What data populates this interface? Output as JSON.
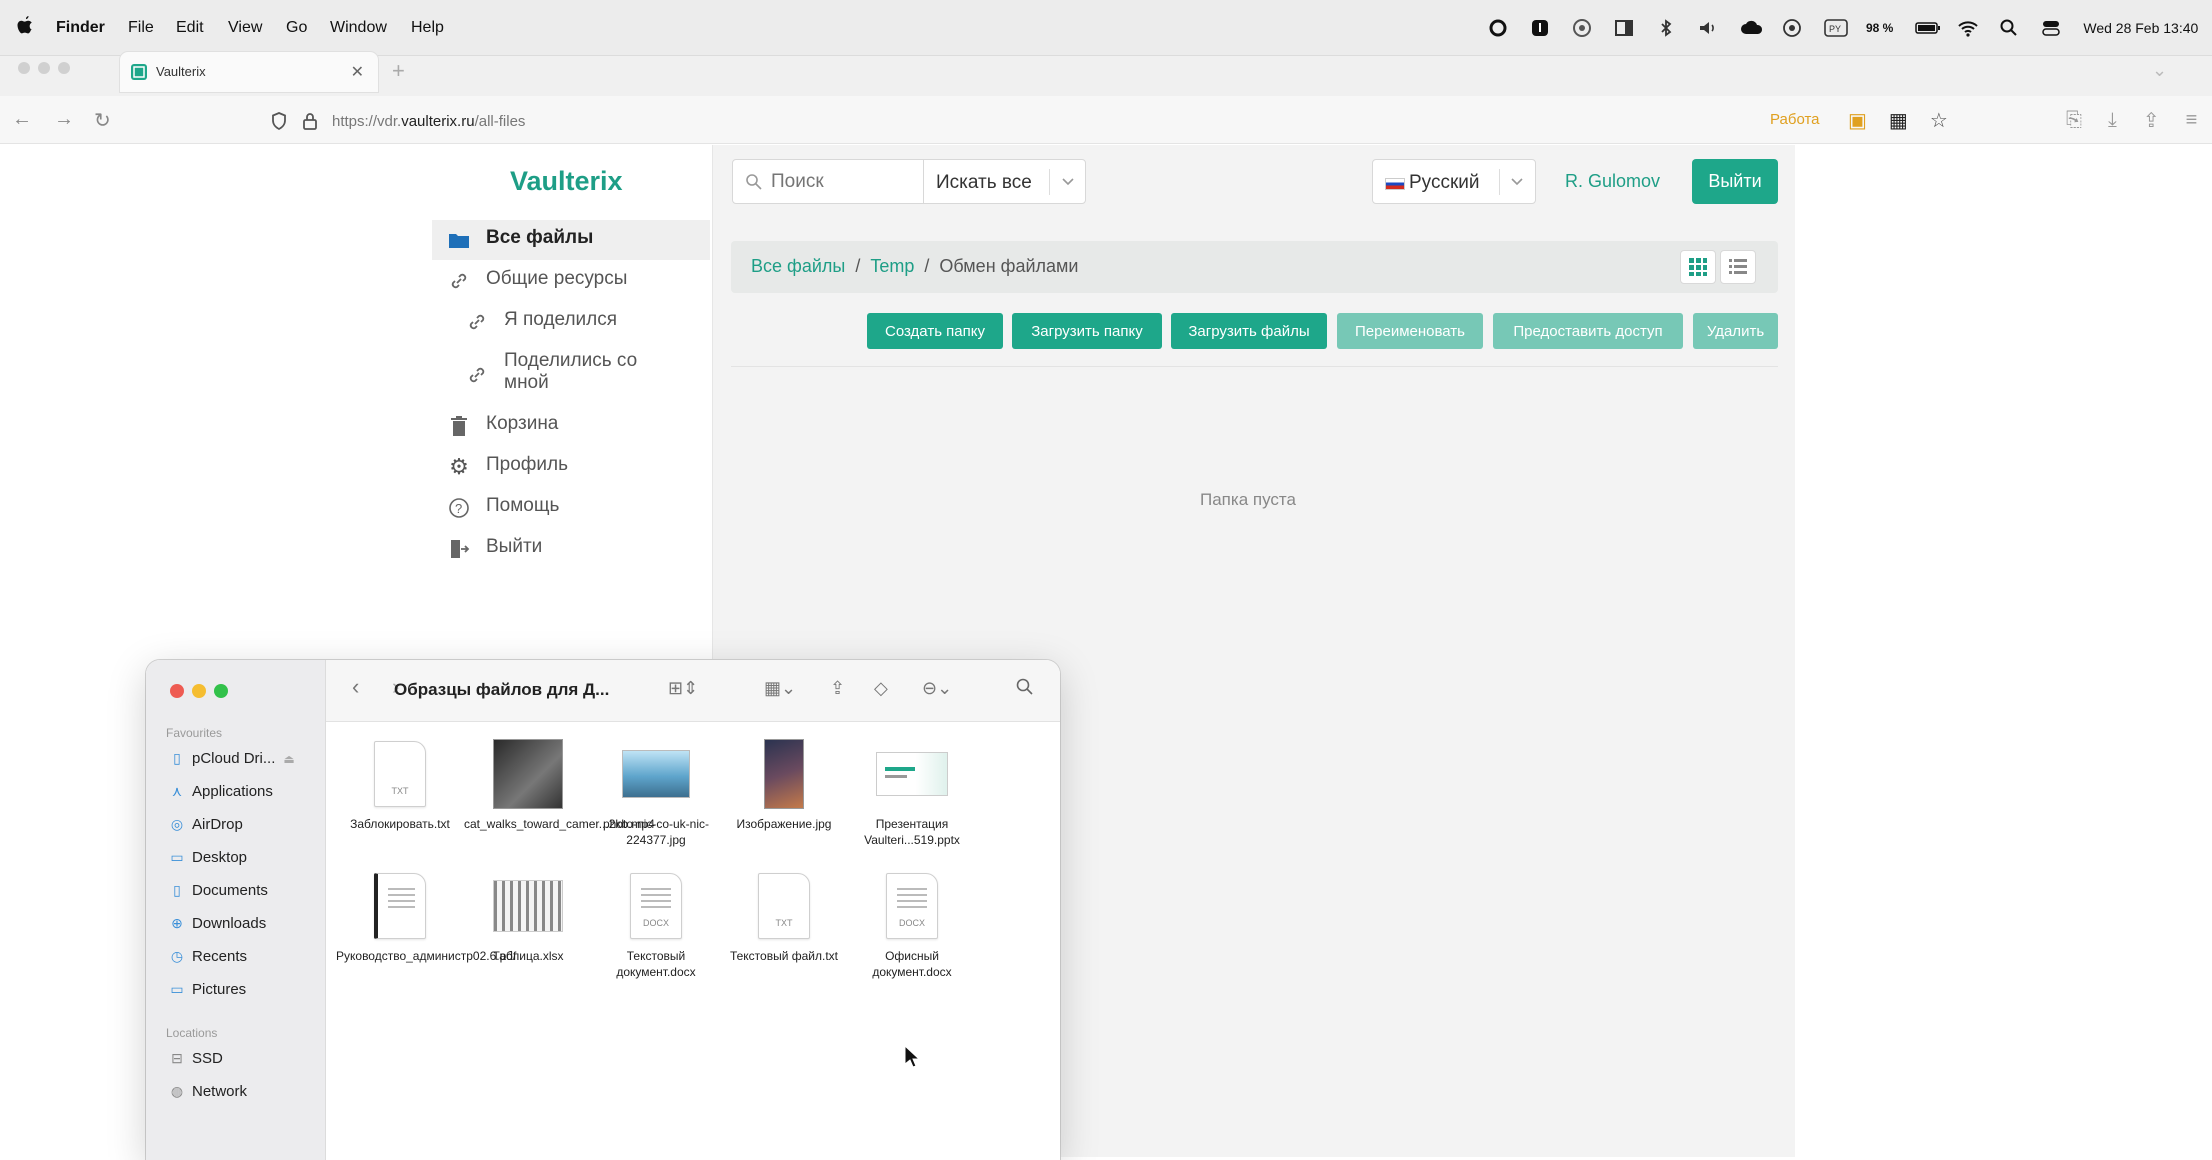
{
  "menubar": {
    "app": "Finder",
    "items": [
      "File",
      "Edit",
      "View",
      "Go",
      "Window",
      "Help"
    ],
    "battery": "98 %",
    "clock": "Wed 28 Feb 13:40"
  },
  "browser": {
    "tab_title": "Vaulterix",
    "url_prefix": "https://vdr.",
    "url_domain": "vaulterix.ru",
    "url_path": "/all-files",
    "profile_label": "Работа"
  },
  "app": {
    "logo": "Vaulterix",
    "nav": {
      "all_files": "Все файлы",
      "shared": "Общие ресурсы",
      "shared_by_me": "Я поделился",
      "shared_with_me": "Поделились со мной",
      "trash": "Корзина",
      "profile": "Профиль",
      "help": "Помощь",
      "logout": "Выйти"
    },
    "search": {
      "placeholder": "Поиск",
      "scope": "Искать все"
    },
    "language": "Русский",
    "user": "R. Gulomov",
    "logout_button": "Выйти",
    "breadcrumb": {
      "root": "Все файлы",
      "mid": "Temp",
      "current": "Обмен файлами",
      "sep": "/"
    },
    "actions": {
      "create_folder": "Создать папку",
      "upload_folder": "Загрузить папку",
      "upload_files": "Загрузить файлы",
      "rename": "Переименовать",
      "share": "Предоставить доступ",
      "delete": "Удалить"
    },
    "empty_text": "Папка пуста"
  },
  "finder": {
    "title": "Образцы файлов для Д...",
    "sidebar": {
      "favourites_label": "Favourites",
      "locations_label": "Locations",
      "favourites": [
        "pCloud Dri...",
        "Applications",
        "AirDrop",
        "Desktop",
        "Documents",
        "Downloads",
        "Recents",
        "Pictures"
      ],
      "locations": [
        "SSD",
        "Network"
      ]
    },
    "files": [
      {
        "name": "Заблокировать.txt",
        "kind": "TXT"
      },
      {
        "name": "cat_walks_toward_camer...2kb.mp4",
        "kind": "video"
      },
      {
        "name": "photo-nic-co-uk-nic-224377.jpg",
        "kind": "photo"
      },
      {
        "name": "Изображение.jpg",
        "kind": "image"
      },
      {
        "name": "Презентация Vaulteri...519.pptx",
        "kind": "pptx"
      },
      {
        "name": "Руководство_администр02.6.pdf",
        "kind": "pdf"
      },
      {
        "name": "Таблица.xlsx",
        "kind": "xlsx"
      },
      {
        "name": "Текстовый документ.docx",
        "kind": "DOCX"
      },
      {
        "name": "Текстовый файл.txt",
        "kind": "TXT"
      },
      {
        "name": "Офисный документ.docx",
        "kind": "DOCX"
      }
    ]
  },
  "colors": {
    "accent": "#1ea78a",
    "accent_disabled": "#77c8b6",
    "link": "#1e9e86"
  }
}
